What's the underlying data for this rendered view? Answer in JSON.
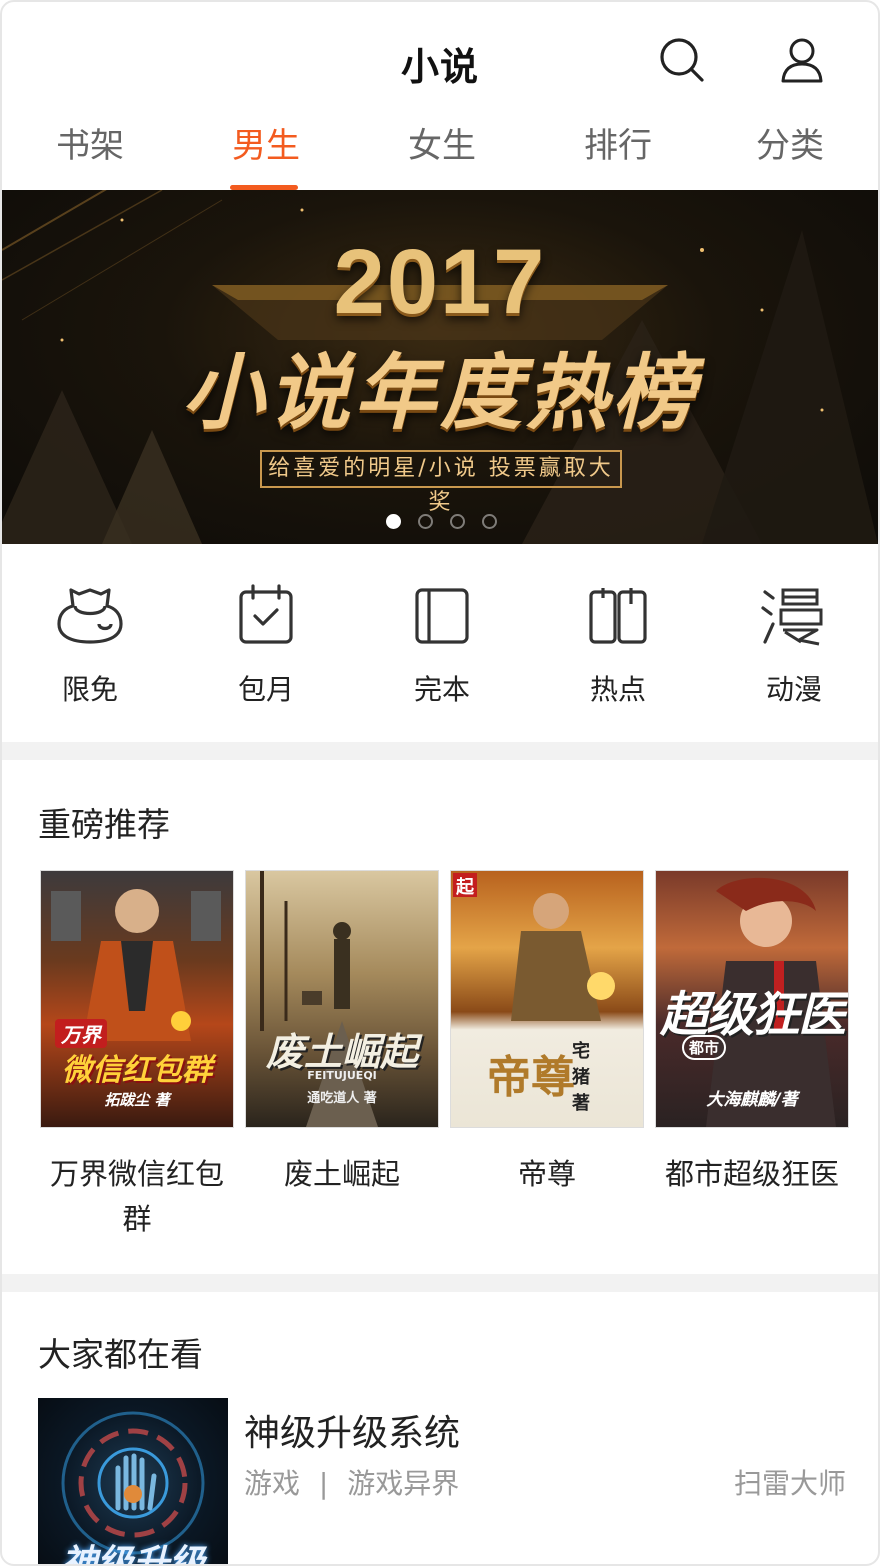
{
  "header": {
    "title": "小说",
    "icons": [
      "search-icon",
      "user-icon"
    ]
  },
  "tabs": [
    {
      "label": "书架",
      "active": false
    },
    {
      "label": "男生",
      "active": true
    },
    {
      "label": "女生",
      "active": false
    },
    {
      "label": "排行",
      "active": false
    },
    {
      "label": "分类",
      "active": false
    }
  ],
  "banner": {
    "year": "2017",
    "headline": "小说年度热榜",
    "subline": "给喜爱的明星/小说 投票赢取大奖",
    "slide_count": 4,
    "active_slide": 0
  },
  "quick_nav": [
    {
      "label": "限免",
      "icon": "free-icon"
    },
    {
      "label": "包月",
      "icon": "calendar-icon"
    },
    {
      "label": "完本",
      "icon": "book-complete-icon"
    },
    {
      "label": "热点",
      "icon": "hot-book-icon"
    },
    {
      "label": "动漫",
      "icon": "comic-icon"
    }
  ],
  "recommend": {
    "title": "重磅推荐",
    "books": [
      {
        "name": "万界微信红包群",
        "cover_text": "微信红包群",
        "cover_tag": "万界",
        "cover_author": "拓跋尘 著"
      },
      {
        "name": "废土崛起",
        "cover_text": "废土崛起",
        "cover_tag": "FEITUJUEQI",
        "cover_author": "通吃道人 著"
      },
      {
        "name": "帝尊",
        "cover_text": "帝尊",
        "cover_tag": "起",
        "cover_author": "宅猪 著"
      },
      {
        "name": "都市超级狂医",
        "cover_text": "超级狂医",
        "cover_tag": "都市",
        "cover_author": "大海麒麟/著"
      }
    ]
  },
  "popular": {
    "title": "大家都在看",
    "items": [
      {
        "name": "神级升级系统",
        "category": "游戏",
        "subcategory": "游戏异界",
        "separator": "|",
        "author": "扫雷大师",
        "cover_text": "神级升级"
      }
    ]
  },
  "colors": {
    "accent": "#f35b1f",
    "text": "#222222",
    "muted": "#999999",
    "divider": "#f2f2f2"
  }
}
